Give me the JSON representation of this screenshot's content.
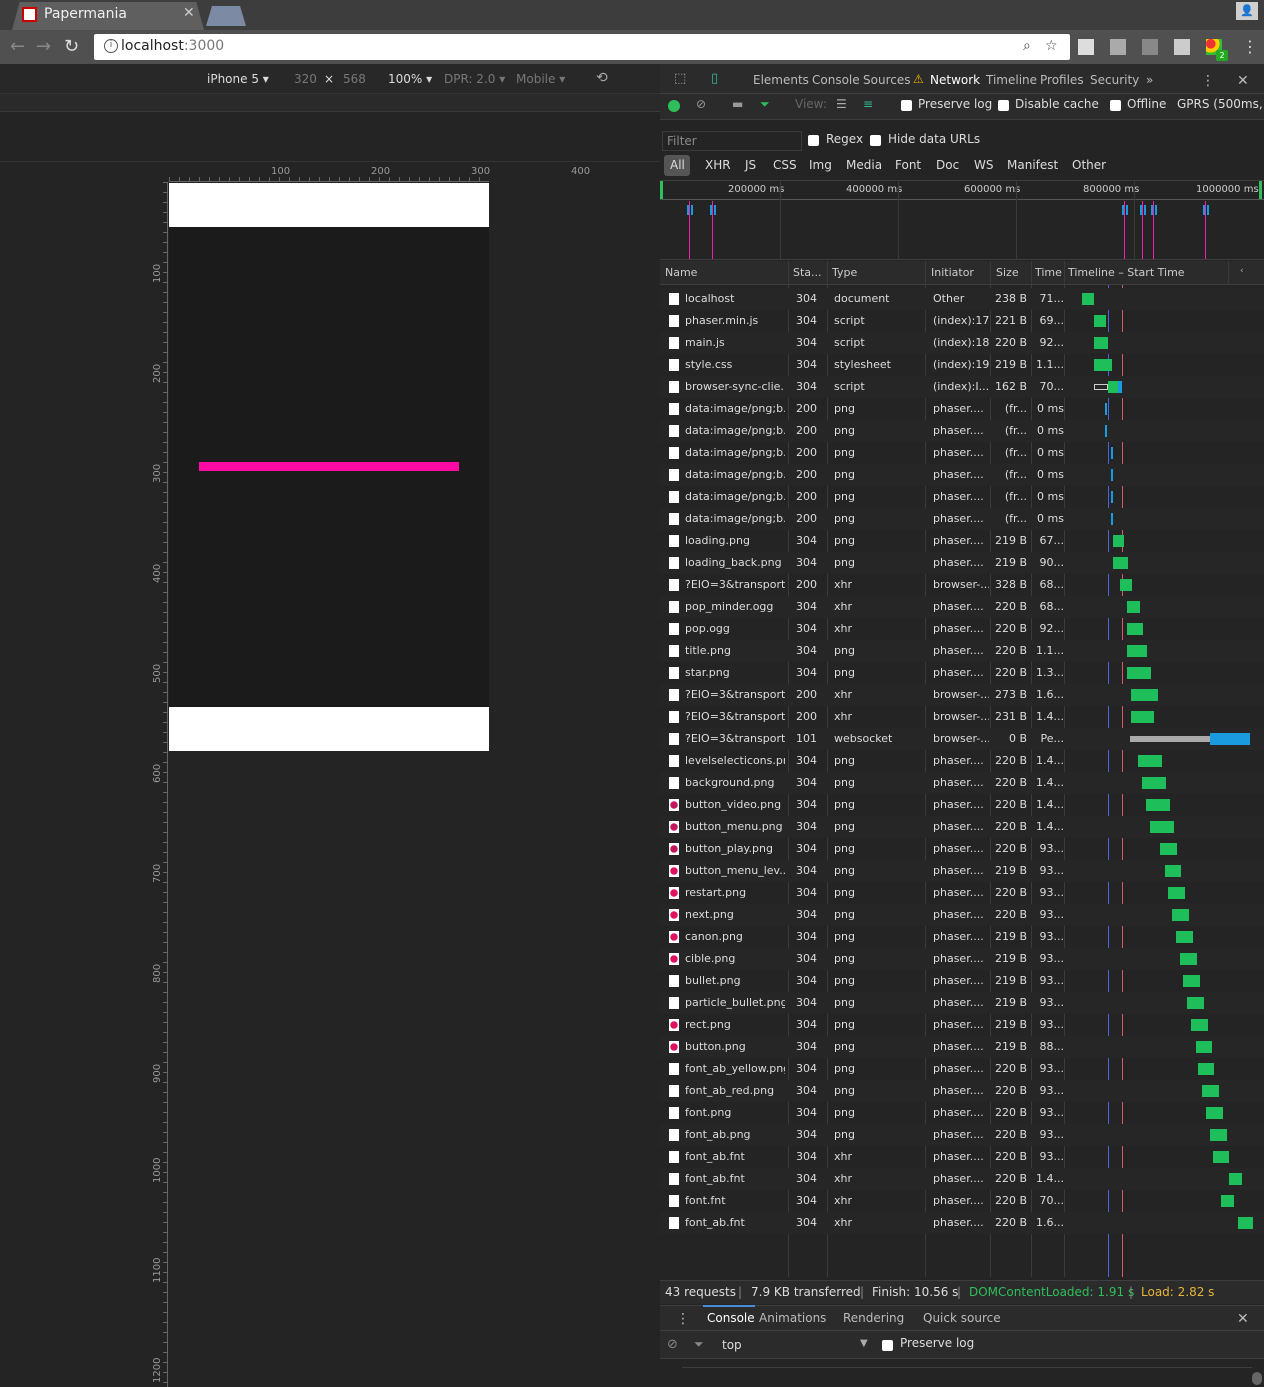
{
  "browser": {
    "tab_title": "Papermania",
    "url_host": "localhost",
    "url_port": ":3000",
    "profile_badge": "2"
  },
  "device": {
    "model": "iPhone 5",
    "width": "320",
    "times": "×",
    "height": "568",
    "zoom": "100%",
    "dpr": "DPR: 2.0",
    "mode": "Mobile"
  },
  "rulers": {
    "h": [
      "100",
      "200",
      "300",
      "400"
    ],
    "v": [
      "100",
      "200",
      "300",
      "400",
      "500",
      "600",
      "700",
      "800",
      "900",
      "1000",
      "1100",
      "1200"
    ]
  },
  "devtools": {
    "tabs": [
      "Elements",
      "Console",
      "Sources",
      "Network",
      "Timeline",
      "Profiles",
      "Security"
    ],
    "active_tab": "Network",
    "more": "»"
  },
  "network": {
    "view_label": "View:",
    "preserve_log": "Preserve log",
    "disable_cache": "Disable cache",
    "offline": "Offline",
    "throttle": "GPRS (500ms, 5",
    "filter_placeholder": "Filter",
    "regex": "Regex",
    "hide_data_urls": "Hide data URLs",
    "type_filters": [
      "All",
      "XHR",
      "JS",
      "CSS",
      "Img",
      "Media",
      "Font",
      "Doc",
      "WS",
      "Manifest",
      "Other"
    ],
    "overview_labels": [
      "200000 ms",
      "400000 ms",
      "600000 ms",
      "800000 ms",
      "1000000 ms"
    ],
    "columns": [
      "Name",
      "Sta...",
      "Type",
      "Initiator",
      "Size",
      "Time",
      "Timeline – Start Time"
    ],
    "rows": [
      {
        "name": "localhost",
        "status": "304",
        "type": "document",
        "initiator": "Other",
        "size": "238 B",
        "time": "71..."
      },
      {
        "name": "phaser.min.js",
        "status": "304",
        "type": "script",
        "initiator": "(index):17",
        "size": "221 B",
        "time": "69..."
      },
      {
        "name": "main.js",
        "status": "304",
        "type": "script",
        "initiator": "(index):18",
        "size": "220 B",
        "time": "92..."
      },
      {
        "name": "style.css",
        "status": "304",
        "type": "stylesheet",
        "initiator": "(index):19",
        "size": "219 B",
        "time": "1.1..."
      },
      {
        "name": "browser-sync-clie...",
        "status": "304",
        "type": "script",
        "initiator": "(index):I...",
        "size": "162 B",
        "time": "70..."
      },
      {
        "name": "data:image/png;b...",
        "status": "200",
        "type": "png",
        "initiator": "phaser....",
        "size": "(fr...",
        "time": "0 ms"
      },
      {
        "name": "data:image/png;b...",
        "status": "200",
        "type": "png",
        "initiator": "phaser....",
        "size": "(fr...",
        "time": "0 ms"
      },
      {
        "name": "data:image/png;b...",
        "status": "200",
        "type": "png",
        "initiator": "phaser....",
        "size": "(fr...",
        "time": "0 ms"
      },
      {
        "name": "data:image/png;b...",
        "status": "200",
        "type": "png",
        "initiator": "phaser....",
        "size": "(fr...",
        "time": "0 ms"
      },
      {
        "name": "data:image/png;b...",
        "status": "200",
        "type": "png",
        "initiator": "phaser....",
        "size": "(fr...",
        "time": "0 ms"
      },
      {
        "name": "data:image/png;b...",
        "status": "200",
        "type": "png",
        "initiator": "phaser....",
        "size": "(fr...",
        "time": "0 ms"
      },
      {
        "name": "loading.png",
        "status": "304",
        "type": "png",
        "initiator": "phaser....",
        "size": "219 B",
        "time": "67..."
      },
      {
        "name": "loading_back.png",
        "status": "304",
        "type": "png",
        "initiator": "phaser....",
        "size": "219 B",
        "time": "90..."
      },
      {
        "name": "?EIO=3&transport...",
        "status": "200",
        "type": "xhr",
        "initiator": "browser-...",
        "size": "328 B",
        "time": "68..."
      },
      {
        "name": "pop_minder.ogg",
        "status": "304",
        "type": "xhr",
        "initiator": "phaser....",
        "size": "220 B",
        "time": "68..."
      },
      {
        "name": "pop.ogg",
        "status": "304",
        "type": "xhr",
        "initiator": "phaser....",
        "size": "220 B",
        "time": "92..."
      },
      {
        "name": "title.png",
        "status": "304",
        "type": "png",
        "initiator": "phaser....",
        "size": "220 B",
        "time": "1.1..."
      },
      {
        "name": "star.png",
        "status": "304",
        "type": "png",
        "initiator": "phaser....",
        "size": "220 B",
        "time": "1.3..."
      },
      {
        "name": "?EIO=3&transport...",
        "status": "200",
        "type": "xhr",
        "initiator": "browser-...",
        "size": "273 B",
        "time": "1.6..."
      },
      {
        "name": "?EIO=3&transport...",
        "status": "200",
        "type": "xhr",
        "initiator": "browser-...",
        "size": "231 B",
        "time": "1.4..."
      },
      {
        "name": "?EIO=3&transport...",
        "status": "101",
        "type": "websocket",
        "initiator": "browser-...",
        "size": "0 B",
        "time": "Pe..."
      },
      {
        "name": "levelselecticons.png",
        "status": "304",
        "type": "png",
        "initiator": "phaser....",
        "size": "220 B",
        "time": "1.4..."
      },
      {
        "name": "background.png",
        "status": "304",
        "type": "png",
        "initiator": "phaser....",
        "size": "220 B",
        "time": "1.4..."
      },
      {
        "name": "button_video.png",
        "status": "304",
        "type": "png",
        "initiator": "phaser....",
        "size": "220 B",
        "time": "1.4..."
      },
      {
        "name": "button_menu.png",
        "status": "304",
        "type": "png",
        "initiator": "phaser....",
        "size": "220 B",
        "time": "1.4..."
      },
      {
        "name": "button_play.png",
        "status": "304",
        "type": "png",
        "initiator": "phaser....",
        "size": "220 B",
        "time": "93..."
      },
      {
        "name": "button_menu_lev...",
        "status": "304",
        "type": "png",
        "initiator": "phaser....",
        "size": "219 B",
        "time": "93..."
      },
      {
        "name": "restart.png",
        "status": "304",
        "type": "png",
        "initiator": "phaser....",
        "size": "220 B",
        "time": "93..."
      },
      {
        "name": "next.png",
        "status": "304",
        "type": "png",
        "initiator": "phaser....",
        "size": "220 B",
        "time": "93..."
      },
      {
        "name": "canon.png",
        "status": "304",
        "type": "png",
        "initiator": "phaser....",
        "size": "219 B",
        "time": "93..."
      },
      {
        "name": "cible.png",
        "status": "304",
        "type": "png",
        "initiator": "phaser....",
        "size": "219 B",
        "time": "93..."
      },
      {
        "name": "bullet.png",
        "status": "304",
        "type": "png",
        "initiator": "phaser....",
        "size": "219 B",
        "time": "93..."
      },
      {
        "name": "particle_bullet.png",
        "status": "304",
        "type": "png",
        "initiator": "phaser....",
        "size": "219 B",
        "time": "93..."
      },
      {
        "name": "rect.png",
        "status": "304",
        "type": "png",
        "initiator": "phaser....",
        "size": "219 B",
        "time": "93..."
      },
      {
        "name": "button.png",
        "status": "304",
        "type": "png",
        "initiator": "phaser....",
        "size": "219 B",
        "time": "88..."
      },
      {
        "name": "font_ab_yellow.png",
        "status": "304",
        "type": "png",
        "initiator": "phaser....",
        "size": "220 B",
        "time": "93..."
      },
      {
        "name": "font_ab_red.png",
        "status": "304",
        "type": "png",
        "initiator": "phaser....",
        "size": "220 B",
        "time": "93..."
      },
      {
        "name": "font.png",
        "status": "304",
        "type": "png",
        "initiator": "phaser....",
        "size": "220 B",
        "time": "93..."
      },
      {
        "name": "font_ab.png",
        "status": "304",
        "type": "png",
        "initiator": "phaser....",
        "size": "220 B",
        "time": "93..."
      },
      {
        "name": "font_ab.fnt",
        "status": "304",
        "type": "xhr",
        "initiator": "phaser....",
        "size": "220 B",
        "time": "93..."
      },
      {
        "name": "font_ab.fnt",
        "status": "304",
        "type": "xhr",
        "initiator": "phaser....",
        "size": "220 B",
        "time": "1.4..."
      },
      {
        "name": "font.fnt",
        "status": "304",
        "type": "xhr",
        "initiator": "phaser....",
        "size": "220 B",
        "time": "70..."
      },
      {
        "name": "font_ab.fnt",
        "status": "304",
        "type": "xhr",
        "initiator": "phaser....",
        "size": "220 B",
        "time": "1.6..."
      }
    ],
    "summary": {
      "requests": "43 requests",
      "transferred": "7.9 KB transferred",
      "finish": "Finish: 10.56 s",
      "dom": "DOMContentLoaded: 1.91 s",
      "load": "Load: 2.82 s",
      "dom_color": "#2fbf5a",
      "load_color": "#e8b53a"
    }
  },
  "drawer": {
    "tabs": [
      "Console",
      "Animations",
      "Rendering",
      "Quick source"
    ],
    "context": "top",
    "preserve_log": "Preserve log"
  },
  "colors": {
    "bar_accent": "#ff0aa4",
    "wf_green": "#1ebf5a",
    "wf_blue": "#1a9be0"
  }
}
